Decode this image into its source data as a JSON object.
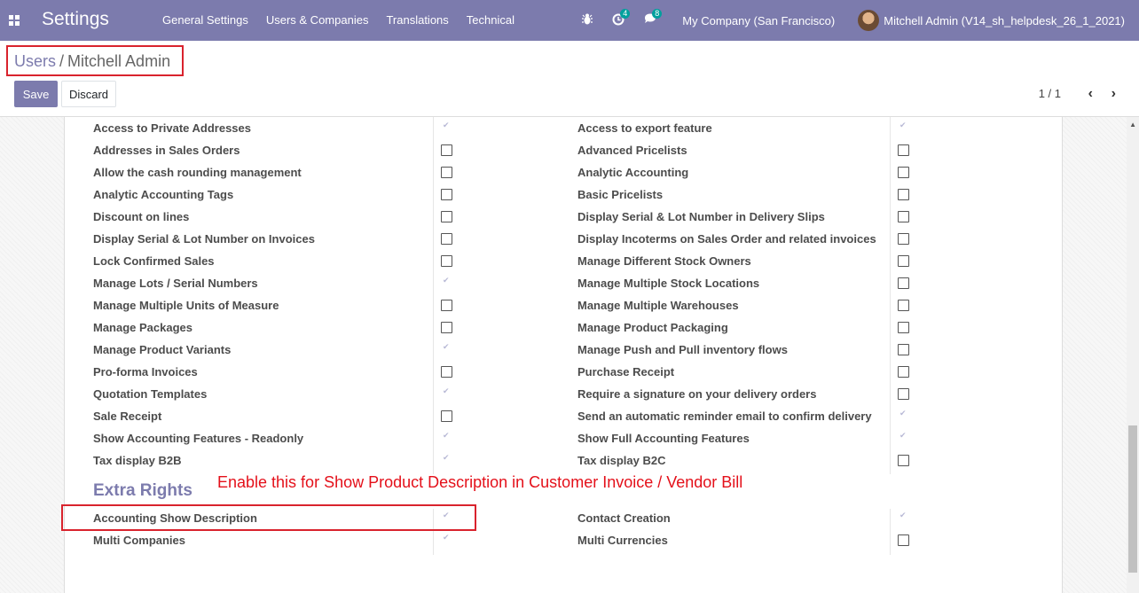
{
  "navbar": {
    "brand": "Settings",
    "menu": [
      "General Settings",
      "Users & Companies",
      "Translations",
      "Technical"
    ],
    "activity_count": "4",
    "message_count": "8",
    "company": "My Company (San Francisco)",
    "user": "Mitchell Admin (V14_sh_helpdesk_26_1_2021)"
  },
  "breadcrumb": {
    "parent": "Users",
    "separator": "/",
    "current": "Mitchell Admin"
  },
  "buttons": {
    "save": "Save",
    "discard": "Discard"
  },
  "pager": {
    "value": "1 / 1",
    "prev": "‹",
    "next": "›"
  },
  "rights_left": [
    {
      "label": "Access to Private Addresses",
      "checked": true
    },
    {
      "label": "Addresses in Sales Orders",
      "checked": false
    },
    {
      "label": "Allow the cash rounding management",
      "checked": false
    },
    {
      "label": "Analytic Accounting Tags",
      "checked": false
    },
    {
      "label": "Discount on lines",
      "checked": false
    },
    {
      "label": "Display Serial & Lot Number on Invoices",
      "checked": false
    },
    {
      "label": "Lock Confirmed Sales",
      "checked": false
    },
    {
      "label": "Manage Lots / Serial Numbers",
      "checked": true
    },
    {
      "label": "Manage Multiple Units of Measure",
      "checked": false
    },
    {
      "label": "Manage Packages",
      "checked": false
    },
    {
      "label": "Manage Product Variants",
      "checked": true
    },
    {
      "label": "Pro-forma Invoices",
      "checked": false
    },
    {
      "label": "Quotation Templates",
      "checked": true
    },
    {
      "label": "Sale Receipt",
      "checked": false
    },
    {
      "label": "Show Accounting Features - Readonly",
      "checked": true
    },
    {
      "label": "Tax display B2B",
      "checked": true
    }
  ],
  "rights_right": [
    {
      "label": "Access to export feature",
      "checked": true
    },
    {
      "label": "Advanced Pricelists",
      "checked": false
    },
    {
      "label": "Analytic Accounting",
      "checked": false
    },
    {
      "label": "Basic Pricelists",
      "checked": false
    },
    {
      "label": "Display Serial & Lot Number in Delivery Slips",
      "checked": false
    },
    {
      "label": "Display Incoterms on Sales Order and related invoices",
      "checked": false
    },
    {
      "label": "Manage Different Stock Owners",
      "checked": false
    },
    {
      "label": "Manage Multiple Stock Locations",
      "checked": false
    },
    {
      "label": "Manage Multiple Warehouses",
      "checked": false
    },
    {
      "label": "Manage Product Packaging",
      "checked": false
    },
    {
      "label": "Manage Push and Pull inventory flows",
      "checked": false
    },
    {
      "label": "Purchase Receipt",
      "checked": false
    },
    {
      "label": "Require a signature on your delivery orders",
      "checked": false
    },
    {
      "label": "Send an automatic reminder email to confirm delivery",
      "checked": true
    },
    {
      "label": "Show Full Accounting Features",
      "checked": true
    },
    {
      "label": "Tax display B2C",
      "checked": false
    }
  ],
  "extra_rights": {
    "title": "Extra Rights",
    "annotation": "Enable this for Show Product Description in Customer Invoice / Vendor Bill",
    "left": [
      {
        "label": "Accounting Show Description",
        "checked": true
      },
      {
        "label": "Multi Companies",
        "checked": true
      }
    ],
    "right": [
      {
        "label": "Contact Creation",
        "checked": true
      },
      {
        "label": "Multi Currencies",
        "checked": false
      }
    ]
  }
}
